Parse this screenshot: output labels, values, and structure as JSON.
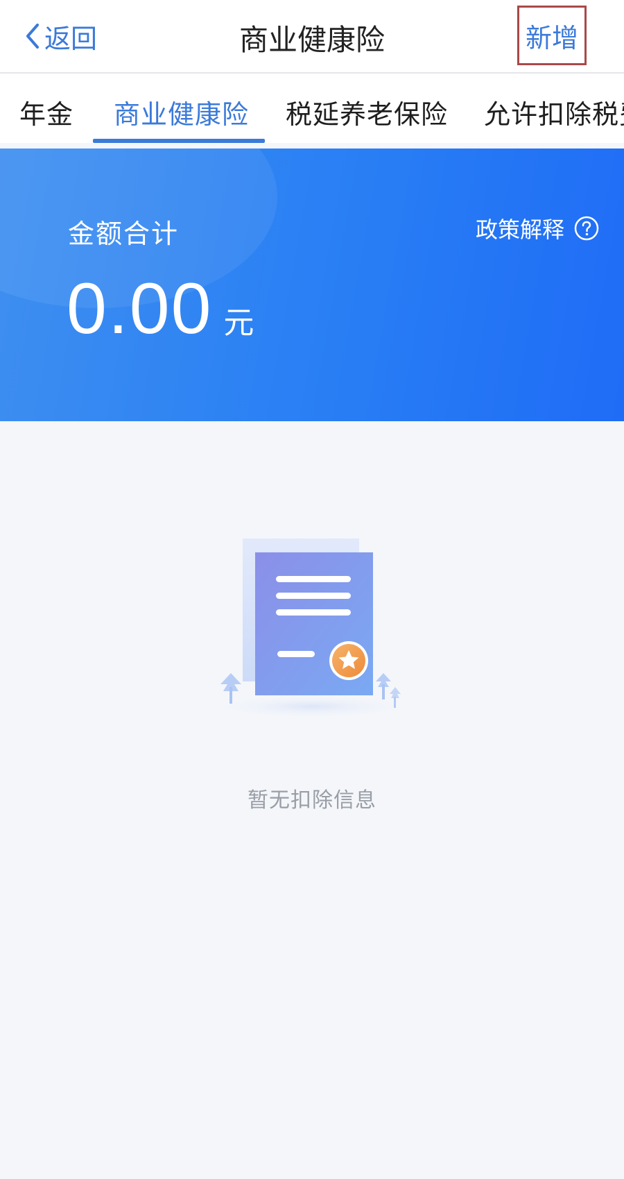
{
  "nav": {
    "back_label": "返回",
    "title": "商业健康险",
    "add_label": "新增"
  },
  "tabs": [
    {
      "label": "年金",
      "active": false
    },
    {
      "label": "商业健康险",
      "active": true
    },
    {
      "label": "税延养老保险",
      "active": false
    },
    {
      "label": "允许扣除税费",
      "active": false
    }
  ],
  "summary": {
    "label": "金额合计",
    "amount": "0.00",
    "unit": "元",
    "policy_label": "政策解释"
  },
  "empty_state": {
    "text": "暂无扣除信息",
    "icon": "certificate-illustration"
  },
  "colors": {
    "accent": "#3b7ad9",
    "banner_start": "#3f8ff0",
    "banner_end": "#1f6cf6",
    "highlight_box": "#a94848",
    "background": "#f4f6fa"
  },
  "icons": {
    "back": "chevron-left-icon",
    "help": "question-circle-icon"
  }
}
